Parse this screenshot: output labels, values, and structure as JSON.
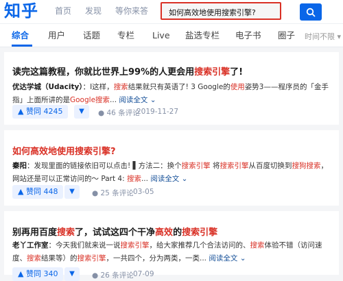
{
  "header": {
    "logo": "知乎",
    "nav": [
      "首页",
      "发现",
      "等你来答"
    ],
    "search_value": "如何高效地使用搜索引擎?"
  },
  "tabs": {
    "items": [
      "综合",
      "用户",
      "话题",
      "专栏",
      "Live",
      "盐选专栏",
      "电子书",
      "圈子"
    ],
    "active": "综合",
    "filter_label": "时间不限"
  },
  "results": [
    {
      "title": "读完这篇教程，你就比世界上99%的人更会用搜索引擎了!",
      "author": "优达学城（Udacity）",
      "excerpt": "：I这样，搜索结果就只有英语了! 3 Google的使用姿势3——程序员的「金手指」上面所讲的是Google搜索...",
      "readmore": "阅读全文",
      "votes": "赞同 4245",
      "comments": "46 条评论",
      "date": "2019-11-27"
    },
    {
      "title": "如何高效地使用搜索引擎?",
      "author": "秦阳",
      "excerpt": "：发现里面的链接依旧可以点击! ▌方法二：换个搜索引擎 将搜索引擎从百度切换到搜狗搜索，网站还是可以正常访问的～ Part 4: 搜索...",
      "readmore": "阅读全文",
      "votes": "赞同 448",
      "comments": "25 条评论",
      "date": "03-05"
    },
    {
      "title": "别再用百度搜索了，试试这四个干净高效的搜索引擎",
      "author": "老丫工作室",
      "excerpt": "：今天我们就来说一说搜索引擎，给大家推荐几个合法访问的、搜索体验不错（访问速度、搜索结果等）的搜索引擎，一共四个，分为两类，一类...",
      "readmore": "阅读全文",
      "votes": "赞同 340",
      "comments": "26 条评论",
      "date": "07-09"
    }
  ],
  "colors": {
    "brand": "#0a66e8",
    "highlight": "#d93025"
  }
}
